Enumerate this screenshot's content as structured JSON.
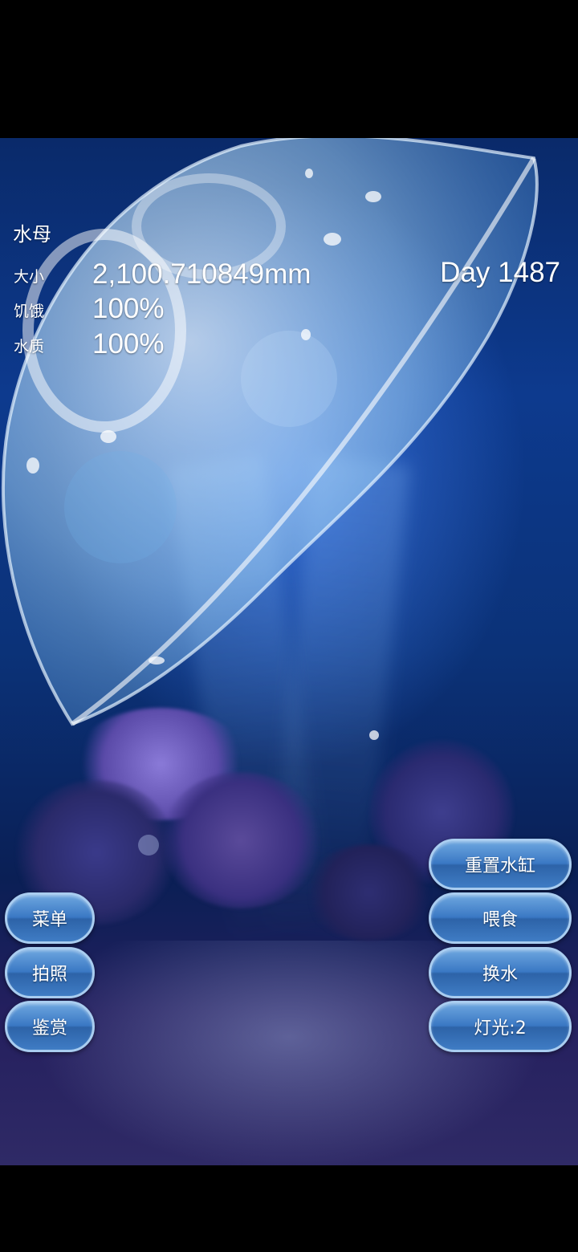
{
  "hud": {
    "title": "水母",
    "stats": [
      {
        "label": "大小",
        "value": "2,100.710849mm"
      },
      {
        "label": "饥饿",
        "value": "100%"
      },
      {
        "label": "水质",
        "value": "100%"
      }
    ],
    "day": "Day 1487"
  },
  "buttons": {
    "left": [
      "菜单",
      "拍照",
      "鉴赏"
    ],
    "right": [
      "重置水缸",
      "喂食",
      "换水",
      "灯光:2"
    ]
  },
  "colors": {
    "button_fill": "#3a78c4",
    "button_border": "#a9cdf0",
    "water_deep": "#0a2a6a"
  }
}
